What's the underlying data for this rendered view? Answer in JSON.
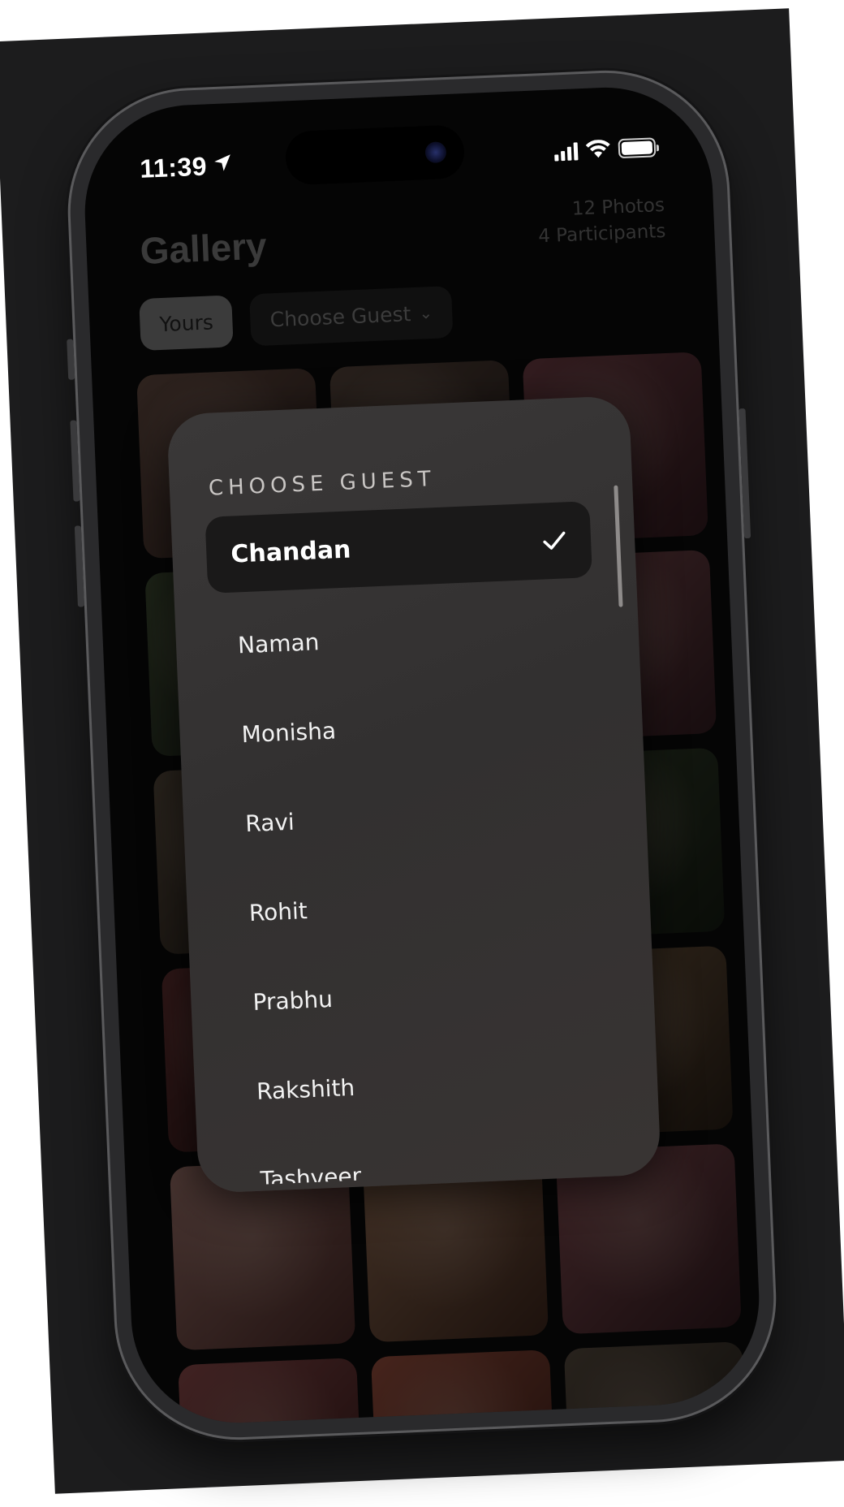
{
  "status_bar": {
    "time": "11:39"
  },
  "header": {
    "title": "Gallery",
    "photos_count": "12 Photos",
    "participants_count": "4 Participants"
  },
  "filters": {
    "yours_label": "Yours",
    "choose_guest_label": "Choose Guest"
  },
  "dropdown": {
    "title": "CHOOSE GUEST",
    "selected": "Chandan",
    "options": [
      {
        "label": "Chandan"
      },
      {
        "label": "Naman"
      },
      {
        "label": "Monisha"
      },
      {
        "label": "Ravi"
      },
      {
        "label": "Rohit"
      },
      {
        "label": "Prabhu"
      },
      {
        "label": "Rakshith"
      },
      {
        "label": "Tashveer"
      }
    ]
  },
  "colors": {
    "background": "#1c1c1d",
    "screen": "#050505",
    "sheet": "#353333",
    "selected_row": "#1a1919",
    "text": "#f2f2f2"
  },
  "icons": {
    "location": "location-arrow-icon",
    "signal": "cellular-signal-icon",
    "wifi": "wifi-icon",
    "battery": "battery-icon",
    "chevron": "chevron-down-icon",
    "check": "checkmark-icon"
  }
}
